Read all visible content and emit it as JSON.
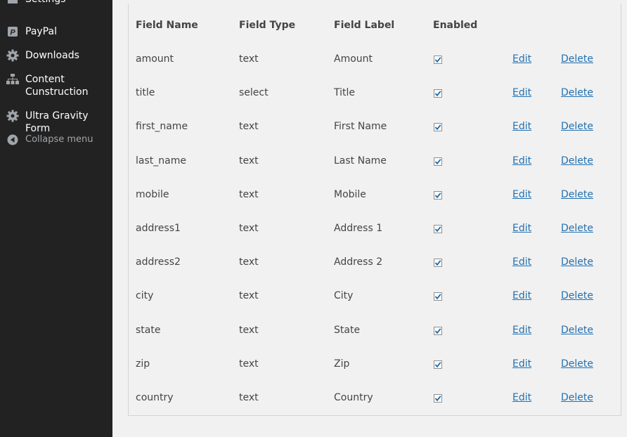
{
  "sidebar": {
    "items": [
      {
        "label": "Settings",
        "icon": "settings-icon"
      },
      {
        "label": "PayPal",
        "icon": "paypal-icon"
      },
      {
        "label": "Downloads",
        "icon": "gear-icon"
      },
      {
        "label": "Content Cunstruction",
        "icon": "hierarchy-icon"
      },
      {
        "label": "Ultra Gravity Form",
        "icon": "gear-icon"
      }
    ],
    "collapse_label": "Collapse menu"
  },
  "table": {
    "headers": {
      "field_name": "Field Name",
      "field_type": "Field Type",
      "field_label": "Field Label",
      "enabled": "Enabled"
    },
    "edit_label": "Edit",
    "delete_label": "Delete",
    "rows": [
      {
        "name": "amount",
        "type": "text",
        "label": "Amount",
        "enabled": true
      },
      {
        "name": "title",
        "type": "select",
        "label": "Title",
        "enabled": true
      },
      {
        "name": "first_name",
        "type": "text",
        "label": "First Name",
        "enabled": true
      },
      {
        "name": "last_name",
        "type": "text",
        "label": "Last Name",
        "enabled": true
      },
      {
        "name": "mobile",
        "type": "text",
        "label": "Mobile",
        "enabled": true
      },
      {
        "name": "address1",
        "type": "text",
        "label": "Address 1",
        "enabled": true
      },
      {
        "name": "address2",
        "type": "text",
        "label": "Address 2",
        "enabled": true
      },
      {
        "name": "city",
        "type": "text",
        "label": "City",
        "enabled": true
      },
      {
        "name": "state",
        "type": "text",
        "label": "State",
        "enabled": true
      },
      {
        "name": "zip",
        "type": "text",
        "label": "Zip",
        "enabled": true
      },
      {
        "name": "country",
        "type": "text",
        "label": "Country",
        "enabled": true
      }
    ]
  },
  "colors": {
    "sidebar_bg": "#222222",
    "link": "#2271b1",
    "text": "#444444"
  }
}
